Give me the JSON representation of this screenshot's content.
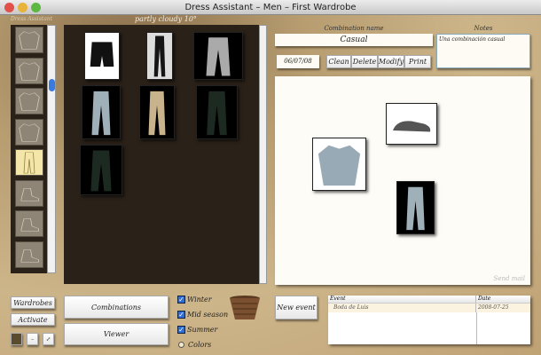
{
  "window": {
    "title": "Dress Assistant – Men – First Wardrobe"
  },
  "app_label": "Dress Assistant",
  "weather": "partly cloudy 10°",
  "combination": {
    "name_label": "Combination name",
    "name_value": "Casual",
    "date": "06/07/08",
    "buttons": [
      "Clean",
      "Delete",
      "Modify",
      "Print"
    ]
  },
  "notes": {
    "label": "Notes",
    "value": "Una combinación casual"
  },
  "canvas": {
    "send_mail": "Send mail"
  },
  "sidebar_thumbs": [
    "sweater",
    "shirt",
    "knit-sweater",
    "t-shirt",
    "pants",
    "boot",
    "shoe",
    "sandal"
  ],
  "sidebar_selected": 4,
  "grid_items": [
    "black-shorts",
    "black-pants",
    "grey-cargo-pants",
    "light-jeans",
    "khaki-pants",
    "dark-pants",
    "dark-pants-2"
  ],
  "canvas_items": [
    "grey-shoe",
    "blue-shirt",
    "light-jeans"
  ],
  "bottom": {
    "wardrobes": "Wardrobes",
    "activate": "Activate",
    "combinations": "Combinations",
    "viewer": "Viewer",
    "new_event": "New event"
  },
  "seasons": [
    {
      "label": "Winter",
      "checked": true
    },
    {
      "label": "Mid season",
      "checked": true
    },
    {
      "label": "Summer",
      "checked": true
    }
  ],
  "colors_label": "Colors",
  "events": {
    "columns": [
      "Event",
      "Date"
    ],
    "rows": [
      {
        "event": "Boda de Luis",
        "date": "2008-07-25"
      }
    ]
  }
}
